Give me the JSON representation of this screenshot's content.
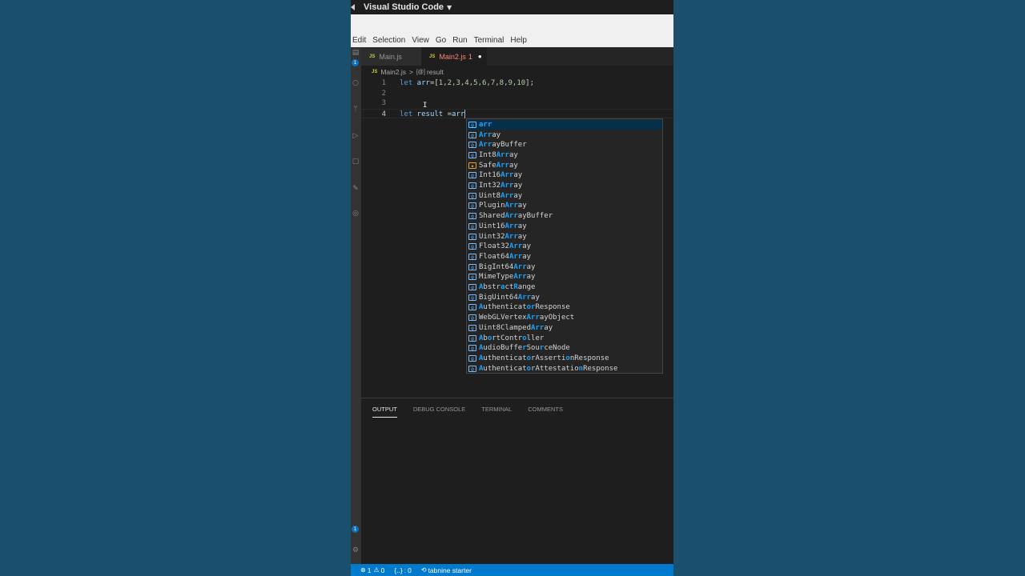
{
  "window": {
    "title": "Visual Studio Code"
  },
  "menu": [
    "Edit",
    "Selection",
    "View",
    "Go",
    "Run",
    "Terminal",
    "Help"
  ],
  "tabs": [
    {
      "icon": "JS",
      "label": "Main.js",
      "active": false
    },
    {
      "icon": "JS",
      "label": "Main2.js",
      "problems": "1",
      "active": true,
      "dirty": "●"
    }
  ],
  "breadcrumb": {
    "file": "Main2.js",
    "separator": ">",
    "symbol_icon": "[@]",
    "symbol": "result"
  },
  "editor": {
    "lines": [
      {
        "num": "1",
        "tokens": [
          {
            "t": "let",
            "c": "kw"
          },
          {
            "t": " arr",
            "c": "var"
          },
          {
            "t": "=[",
            "c": ""
          },
          {
            "t": "1,2,3,4,5,6,7,8,9,10",
            "c": "num-lit"
          },
          {
            "t": "];",
            "c": ""
          }
        ]
      },
      {
        "num": "2",
        "tokens": []
      },
      {
        "num": "3",
        "tokens": []
      },
      {
        "num": "4",
        "tokens": [
          {
            "t": "let",
            "c": "kw"
          },
          {
            "t": " result",
            "c": "var"
          },
          {
            "t": " =",
            "c": ""
          },
          {
            "t": "arr",
            "c": "var"
          }
        ]
      }
    ]
  },
  "suggestions": [
    {
      "label": "arr",
      "match": [
        [
          0,
          3
        ]
      ],
      "kind": "var"
    },
    {
      "label": "Array",
      "match": [
        [
          0,
          3
        ]
      ],
      "kind": "var"
    },
    {
      "label": "ArrayBuffer",
      "match": [
        [
          0,
          3
        ]
      ],
      "kind": "var"
    },
    {
      "label": "Int8Array",
      "match": [
        [
          4,
          7
        ]
      ],
      "kind": "var"
    },
    {
      "label": "SafeArray",
      "match": [
        [
          4,
          7
        ]
      ],
      "kind": "cls"
    },
    {
      "label": "Int16Array",
      "match": [
        [
          5,
          8
        ]
      ],
      "kind": "var"
    },
    {
      "label": "Int32Array",
      "match": [
        [
          5,
          8
        ]
      ],
      "kind": "var"
    },
    {
      "label": "Uint8Array",
      "match": [
        [
          5,
          8
        ]
      ],
      "kind": "var"
    },
    {
      "label": "PluginArray",
      "match": [
        [
          6,
          9
        ]
      ],
      "kind": "var"
    },
    {
      "label": "SharedArrayBuffer",
      "match": [
        [
          6,
          9
        ]
      ],
      "kind": "var"
    },
    {
      "label": "Uint16Array",
      "match": [
        [
          6,
          9
        ]
      ],
      "kind": "var"
    },
    {
      "label": "Uint32Array",
      "match": [
        [
          6,
          9
        ]
      ],
      "kind": "var"
    },
    {
      "label": "Float32Array",
      "match": [
        [
          7,
          10
        ]
      ],
      "kind": "var"
    },
    {
      "label": "Float64Array",
      "match": [
        [
          7,
          10
        ]
      ],
      "kind": "var"
    },
    {
      "label": "BigInt64Array",
      "match": [
        [
          8,
          11
        ]
      ],
      "kind": "var"
    },
    {
      "label": "MimeTypeArray",
      "match": [
        [
          8,
          11
        ]
      ],
      "kind": "var"
    },
    {
      "label": "AbstractRange",
      "match": [
        [
          0,
          1
        ],
        [
          5,
          6
        ],
        [
          8,
          9
        ]
      ],
      "kind": "var"
    },
    {
      "label": "BigUint64Array",
      "match": [
        [
          9,
          12
        ]
      ],
      "kind": "var"
    },
    {
      "label": "AuthenticatorResponse",
      "match": [
        [
          0,
          1
        ],
        [
          11,
          13
        ]
      ],
      "kind": "var"
    },
    {
      "label": "WebGLVertexArrayObject",
      "match": [
        [
          11,
          14
        ]
      ],
      "kind": "var"
    },
    {
      "label": "Uint8ClampedArray",
      "match": [
        [
          12,
          15
        ]
      ],
      "kind": "var"
    },
    {
      "label": "AbortController",
      "match": [
        [
          0,
          1
        ],
        [
          2,
          3
        ],
        [
          10,
          11
        ]
      ],
      "kind": "var"
    },
    {
      "label": "AudioBufferSourceNode",
      "match": [
        [
          0,
          1
        ],
        [
          10,
          11
        ],
        [
          14,
          15
        ]
      ],
      "kind": "var"
    },
    {
      "label": "AuthenticatorAssertionResponse",
      "match": [
        [
          0,
          1
        ],
        [
          11,
          12
        ],
        [
          20,
          21
        ]
      ],
      "kind": "var"
    },
    {
      "label": "AuthenticatorAttestationResponse",
      "match": [
        [
          0,
          1
        ],
        [
          11,
          12
        ],
        [
          23,
          24
        ]
      ],
      "kind": "var"
    }
  ],
  "panel": {
    "tabs": [
      "OUTPUT",
      "DEBUG CONSOLE",
      "TERMINAL",
      "COMMENTS"
    ],
    "active": "OUTPUT"
  },
  "statusbar": {
    "errors": "1",
    "warnings": "0",
    "braces": "{..}",
    "braces_count": "0",
    "tabnine": "tabnine starter"
  },
  "colors": {
    "accent": "#007acc",
    "editor_bg": "#1e1e1e",
    "match": "#18a3ff",
    "background": "#17506f"
  }
}
